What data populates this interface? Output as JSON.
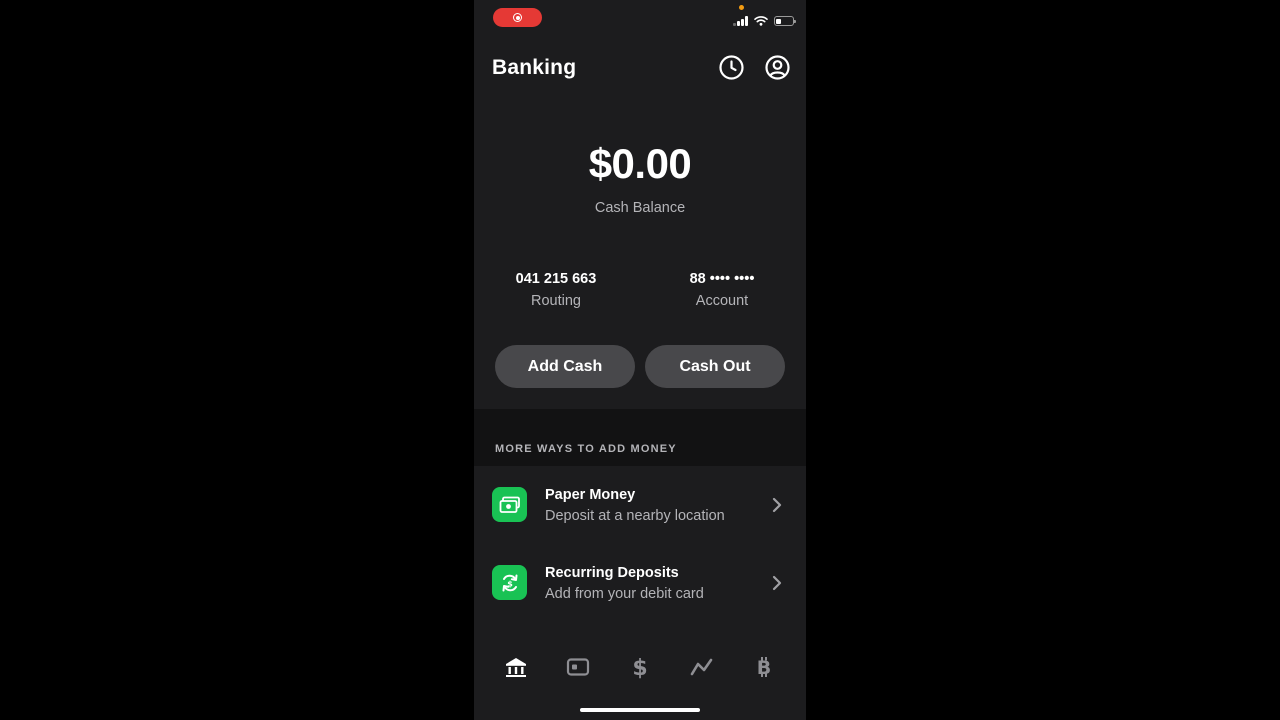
{
  "status_bar": {
    "recording_icon": "screen-record-icon",
    "signal_icon": "cellular-signal-icon",
    "wifi_icon": "wifi-icon",
    "battery_icon": "battery-icon",
    "battery_level": 0.25
  },
  "header": {
    "title": "Banking",
    "history_icon": "clock-icon",
    "profile_icon": "profile-icon"
  },
  "balance": {
    "amount": "$0.00",
    "label": "Cash Balance"
  },
  "account_info": {
    "routing_value": "041 215 663",
    "routing_label": "Routing",
    "account_value": "88 •••• ••••",
    "account_label": "Account"
  },
  "actions": {
    "add_cash_label": "Add Cash",
    "cash_out_label": "Cash Out"
  },
  "more_ways": {
    "header": "MORE WAYS TO ADD MONEY",
    "items": [
      {
        "title": "Paper Money",
        "subtitle": "Deposit at a nearby location",
        "icon": "banknote-icon"
      },
      {
        "title": "Recurring Deposits",
        "subtitle": "Add from your debit card",
        "icon": "recurring-icon"
      }
    ]
  },
  "bottom_nav": {
    "items": [
      {
        "name": "banking",
        "icon": "bank-icon",
        "active": true
      },
      {
        "name": "card",
        "icon": "card-icon",
        "active": false
      },
      {
        "name": "pay",
        "icon": "dollar-icon",
        "active": false
      },
      {
        "name": "investing",
        "icon": "stocks-icon",
        "active": false
      },
      {
        "name": "bitcoin",
        "icon": "bitcoin-icon",
        "active": false
      }
    ]
  },
  "colors": {
    "background": "#1c1c1e",
    "accent_green": "#19c254",
    "button_gray": "#48484b",
    "secondary_text": "#b4b4b8",
    "recording_red": "#e53935"
  }
}
